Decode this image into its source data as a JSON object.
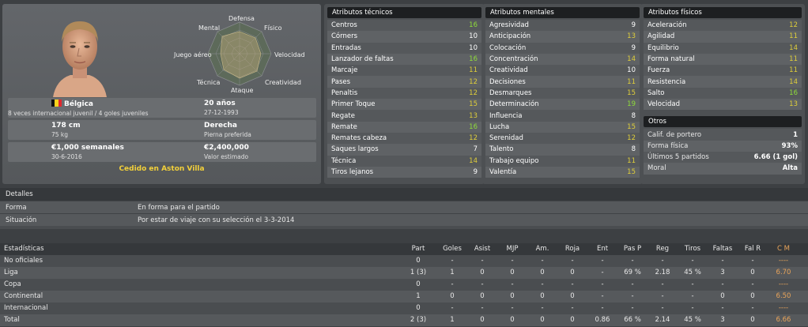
{
  "player": {
    "nationality": "Bélgica",
    "caps": "8 veces internacional juvenil / 4 goles juveniles",
    "age": "20 años",
    "birth": "27-12-1993",
    "height": "178 cm",
    "weight": "75 kg",
    "foot": "Derecha",
    "foot_label": "Pierna preferida",
    "wage": "€1,000 semanales",
    "contract": "30-6-2016",
    "value": "€2,400,000",
    "value_label": "Valor estimado",
    "loan": "Cedido en Aston Villa"
  },
  "radar": {
    "labels": [
      "Defensa",
      "Físico",
      "Velocidad",
      "Creatividad",
      "Ataque",
      "Técnica",
      "Juego aéreo",
      "Mental"
    ]
  },
  "tech": {
    "title": "Atributos técnicos",
    "rows": [
      {
        "name": "Centros",
        "value": "16",
        "c": "g"
      },
      {
        "name": "Córners",
        "value": "10",
        "c": "n"
      },
      {
        "name": "Entradas",
        "value": "10",
        "c": "n"
      },
      {
        "name": "Lanzador de faltas",
        "value": "16",
        "c": "g"
      },
      {
        "name": "Marcaje",
        "value": "11",
        "c": "y"
      },
      {
        "name": "Pases",
        "value": "12",
        "c": "y"
      },
      {
        "name": "Penaltis",
        "value": "12",
        "c": "y"
      },
      {
        "name": "Primer Toque",
        "value": "15",
        "c": "y"
      },
      {
        "name": "Regate",
        "value": "13",
        "c": "y"
      },
      {
        "name": "Remate",
        "value": "16",
        "c": "g"
      },
      {
        "name": "Remates cabeza",
        "value": "12",
        "c": "y"
      },
      {
        "name": "Saques largos",
        "value": "7",
        "c": "n"
      },
      {
        "name": "Técnica",
        "value": "14",
        "c": "y"
      },
      {
        "name": "Tiros lejanos",
        "value": "9",
        "c": "n"
      }
    ]
  },
  "mental": {
    "title": "Atributos mentales",
    "rows": [
      {
        "name": "Agresividad",
        "value": "9",
        "c": "n"
      },
      {
        "name": "Anticipación",
        "value": "13",
        "c": "y"
      },
      {
        "name": "Colocación",
        "value": "9",
        "c": "n"
      },
      {
        "name": "Concentración",
        "value": "14",
        "c": "y"
      },
      {
        "name": "Creatividad",
        "value": "10",
        "c": "n"
      },
      {
        "name": "Decisiones",
        "value": "11",
        "c": "y"
      },
      {
        "name": "Desmarques",
        "value": "15",
        "c": "y"
      },
      {
        "name": "Determinación",
        "value": "19",
        "c": "g"
      },
      {
        "name": "Influencia",
        "value": "8",
        "c": "n"
      },
      {
        "name": "Lucha",
        "value": "15",
        "c": "y"
      },
      {
        "name": "Serenidad",
        "value": "12",
        "c": "y"
      },
      {
        "name": "Talento",
        "value": "8",
        "c": "n"
      },
      {
        "name": "Trabajo equipo",
        "value": "11",
        "c": "y"
      },
      {
        "name": "Valentía",
        "value": "15",
        "c": "y"
      }
    ]
  },
  "physical": {
    "title": "Atributos físicos",
    "rows": [
      {
        "name": "Aceleración",
        "value": "12",
        "c": "y"
      },
      {
        "name": "Agilidad",
        "value": "11",
        "c": "y"
      },
      {
        "name": "Equilibrio",
        "value": "14",
        "c": "y"
      },
      {
        "name": "Forma natural",
        "value": "11",
        "c": "y"
      },
      {
        "name": "Fuerza",
        "value": "11",
        "c": "y"
      },
      {
        "name": "Resistencia",
        "value": "14",
        "c": "y"
      },
      {
        "name": "Salto",
        "value": "16",
        "c": "g"
      },
      {
        "name": "Velocidad",
        "value": "13",
        "c": "y"
      }
    ]
  },
  "otros": {
    "title": "Otros",
    "rows": [
      {
        "name": "Calif. de portero",
        "value": "1"
      },
      {
        "name": "Forma física",
        "value": "93%"
      },
      {
        "name": "Últimos 5 partidos",
        "value": "6.66 (1 gol)"
      },
      {
        "name": "Moral",
        "value": "Alta"
      }
    ]
  },
  "detalles": {
    "title": "Detalles",
    "rows": [
      {
        "k": "Forma",
        "v": "En forma para el partido"
      },
      {
        "k": "Situación",
        "v": "Por estar de viaje con su selección el 3-3-2014"
      }
    ]
  },
  "stats": {
    "title": "Estadísticas",
    "columns": [
      "Part",
      "Goles",
      "Asist",
      "MJP",
      "Am.",
      "Roja",
      "Ent",
      "Pas P",
      "Reg",
      "Tiros",
      "Faltas",
      "Fal R",
      "C M"
    ],
    "rows": [
      {
        "name": "No oficiales",
        "cells": [
          "0",
          "-",
          "-",
          "-",
          "-",
          "-",
          "-",
          "-",
          "-",
          "-",
          "-",
          "-",
          "----"
        ]
      },
      {
        "name": "Liga",
        "cells": [
          "1 (3)",
          "1",
          "0",
          "0",
          "0",
          "0",
          "-",
          "69 %",
          "2.18",
          "45 %",
          "3",
          "0",
          "6.70"
        ]
      },
      {
        "name": "Copa",
        "cells": [
          "0",
          "-",
          "-",
          "-",
          "-",
          "-",
          "-",
          "-",
          "-",
          "-",
          "-",
          "-",
          "----"
        ]
      },
      {
        "name": "Continental",
        "cells": [
          "1",
          "0",
          "0",
          "0",
          "0",
          "0",
          "-",
          "-",
          "-",
          "-",
          "0",
          "0",
          "6.50"
        ]
      },
      {
        "name": "Internacional",
        "cells": [
          "0",
          "-",
          "-",
          "-",
          "-",
          "-",
          "-",
          "-",
          "-",
          "-",
          "-",
          "-",
          "----"
        ]
      },
      {
        "name": "Total",
        "cells": [
          "2 (3)",
          "1",
          "0",
          "0",
          "0",
          "0",
          "0.86",
          "66 %",
          "2.14",
          "45 %",
          "3",
          "0",
          "6.66"
        ]
      }
    ]
  }
}
